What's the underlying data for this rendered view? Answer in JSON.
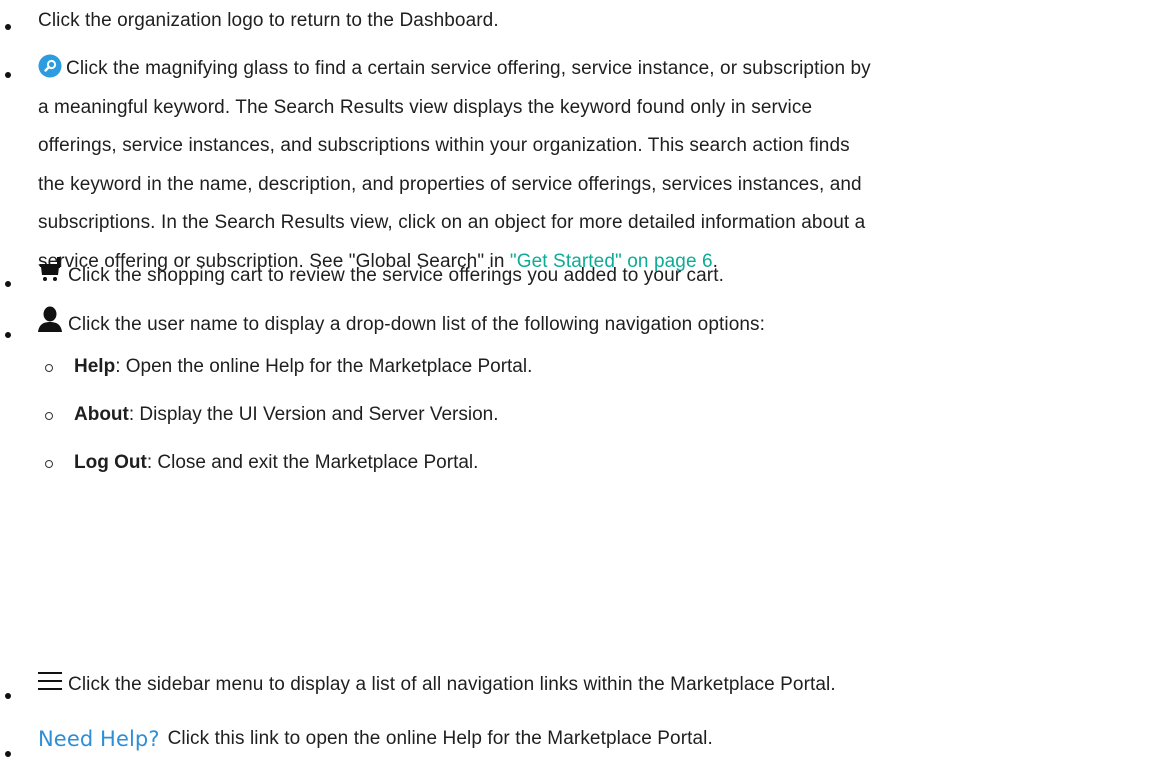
{
  "items": [
    {
      "text": "Click the organization logo to return to the Dashboard."
    },
    {
      "icon": "magnifying-glass-icon",
      "lines": [
        "Click the magnifying glass to find a certain service offering, service instance, or subscription by",
        "a meaningful keyword. The Search Results view displays the keyword found only in service",
        "offerings, service instances, and subscriptions within your organization. This search action finds",
        "the keyword in the name, description, and properties of service offerings, services instances, and",
        "subscriptions. In the Search Results view, click on an object for more detailed information about a"
      ],
      "last_line_prefix": "service offering or subscription. See \"Global Search\" in ",
      "last_line_link": "\"Get Started\" on page 6",
      "last_line_suffix": "."
    },
    {
      "icon": "shopping-cart-icon",
      "text": "Click the shopping cart to review the service offerings you added to your cart."
    },
    {
      "icon": "user-icon",
      "text": "Click the user name to display a drop-down list of the following navigation options:",
      "sub": [
        {
          "label": "Help",
          "text": ": Open the online Help for the Marketplace Portal."
        },
        {
          "label": "About",
          "text": ": Display the UI Version and Server Version."
        },
        {
          "label": "Log Out",
          "text": ": Close and exit the Marketplace Portal."
        }
      ]
    },
    {
      "icon": "hamburger-menu-icon",
      "text": "Click the sidebar menu to display a list of all navigation links within the Marketplace Portal."
    },
    {
      "icon_text": "Need Help?",
      "text": "Click this link to open the online Help for the Marketplace Portal."
    }
  ],
  "colors": {
    "link": "#0eab95",
    "search_icon": "#2b9ce0",
    "need_help": "#2e8fd6"
  }
}
